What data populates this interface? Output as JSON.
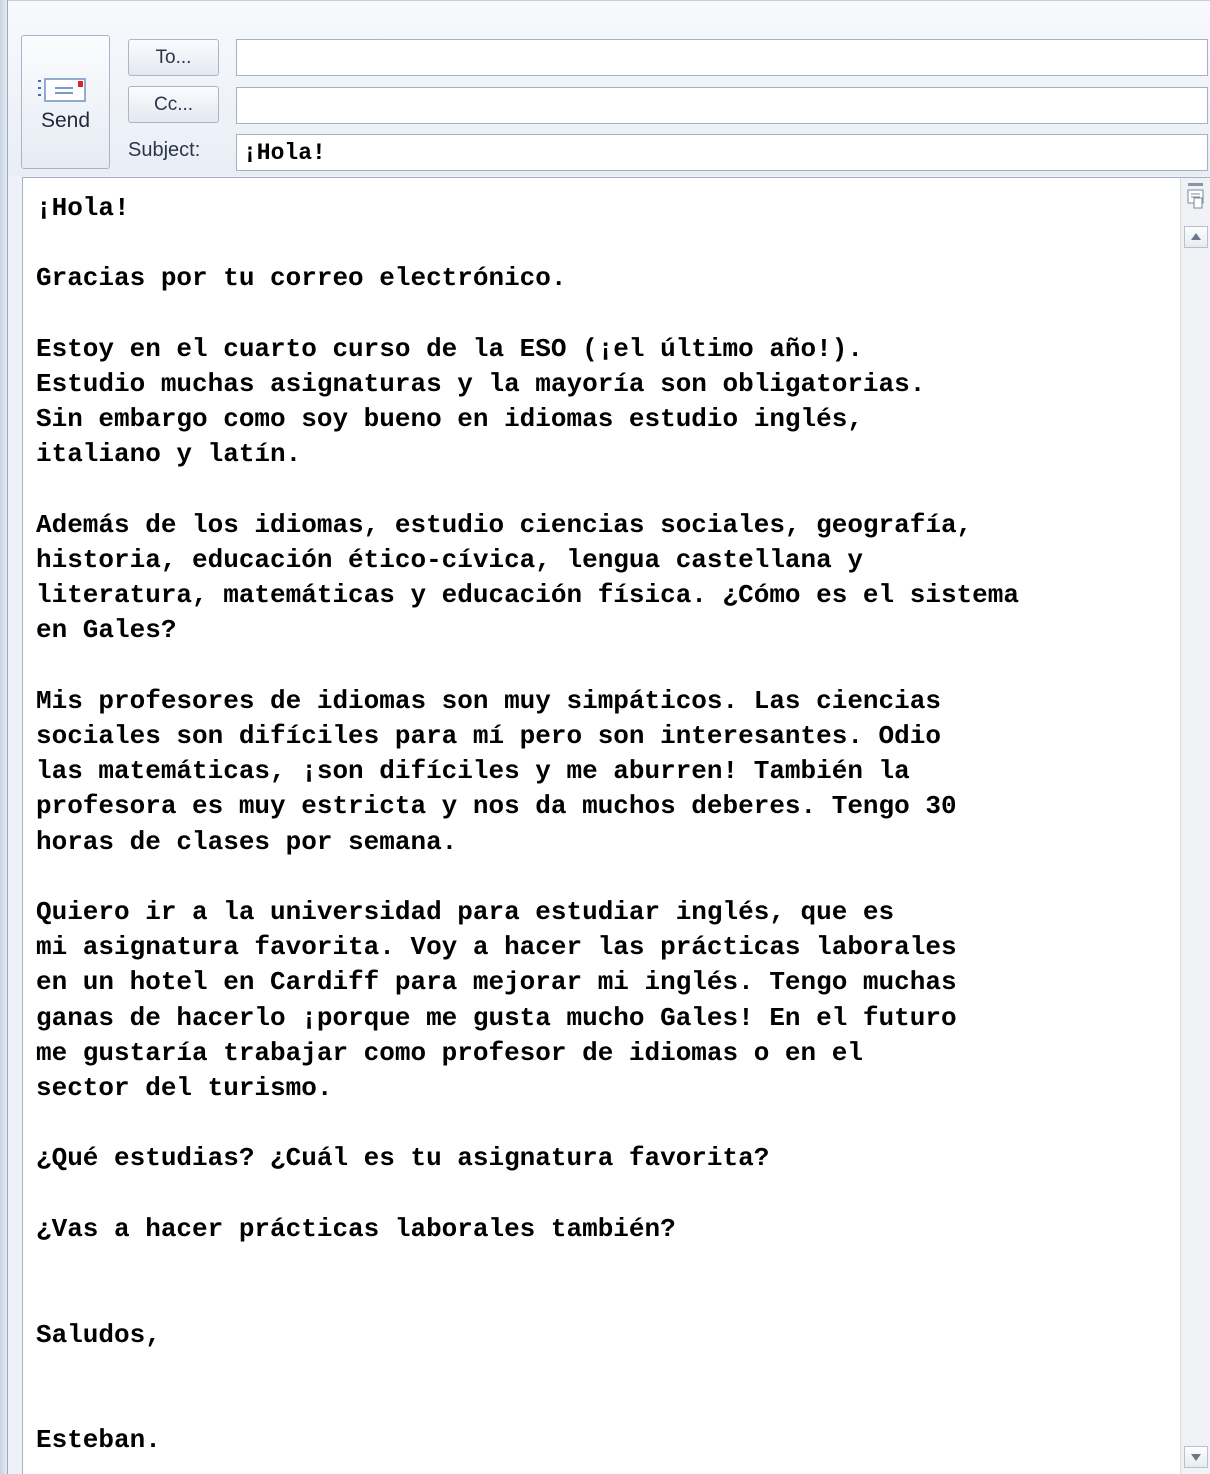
{
  "toolbar": {
    "send_label": "Send",
    "to_label": "To...",
    "cc_label": "Cc...",
    "subject_label": "Subject:"
  },
  "fields": {
    "to_value": "",
    "cc_value": "",
    "subject_value": "¡Hola!"
  },
  "icons": {
    "send": "envelope-send-icon",
    "scroll_top": "view-toggle-icon",
    "scroll_up": "arrow-up-icon",
    "scroll_down": "arrow-down-icon"
  },
  "message": {
    "body": "¡Hola!\n\nGracias por tu correo electrónico.\n\nEstoy en el cuarto curso de la ESO (¡el último año!).\nEstudio muchas asignaturas y la mayoría son obligatorias.\nSin embargo como soy bueno en idiomas estudio inglés,\nitaliano y latín.\n\nAdemás de los idiomas, estudio ciencias sociales, geografía,\nhistoria, educación ético-cívica, lengua castellana y\nliteratura, matemáticas y educación física. ¿Cómo es el sistema\nen Gales?\n\nMis profesores de idiomas son muy simpáticos. Las ciencias\nsociales son difíciles para mí pero son interesantes. Odio\nlas matemáticas, ¡son difíciles y me aburren! También la\nprofesora es muy estricta y nos da muchos deberes. Tengo 30\nhoras de clases por semana.\n\nQuiero ir a la universidad para estudiar inglés, que es\nmi asignatura favorita. Voy a hacer las prácticas laborales\nen un hotel en Cardiff para mejorar mi inglés. Tengo muchas\nganas de hacerlo ¡porque me gusta mucho Gales! En el futuro\nme gustaría trabajar como profesor de idiomas o en el\nsector del turismo.\n\n¿Qué estudias? ¿Cuál es tu asignatura favorita?\n\n¿Vas a hacer prácticas laborales también?\n\n\nSaludos,\n\n\nEsteban."
  }
}
